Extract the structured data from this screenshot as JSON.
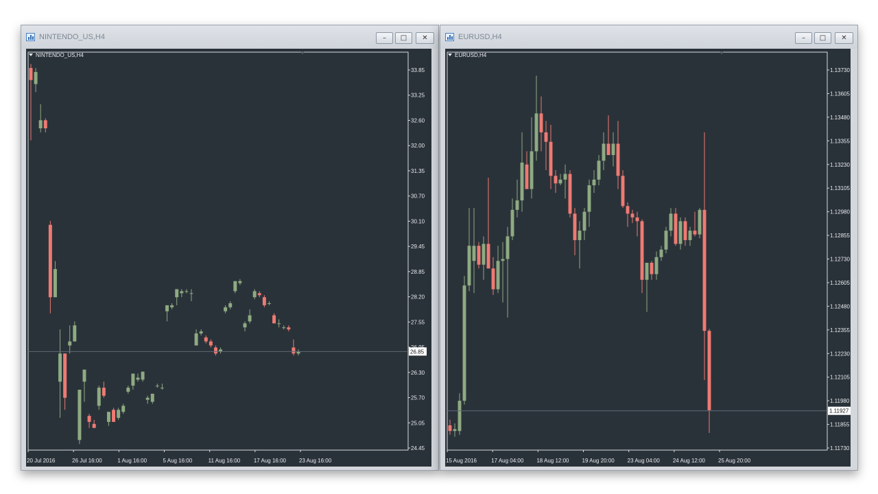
{
  "colors": {
    "bull": "#8eaa82",
    "bear": "#ee7a73",
    "background": "#2a3239",
    "text": "#e8ebee",
    "frame": "#d7dce1"
  },
  "windows": [
    {
      "title": "NINTENDO_US,H4",
      "chart_label": "NINTENDO_US,H4",
      "current_price_label": "26.85",
      "chart_data": {
        "type": "candlestick",
        "symbol": "NINTENDO_US",
        "timeframe": "H4",
        "y_ticks": [
          "33.85",
          "33.25",
          "32.60",
          "32.00",
          "31.35",
          "30.70",
          "30.10",
          "29.45",
          "28.85",
          "28.20",
          "27.55",
          "26.95",
          "26.30",
          "25.70",
          "25.05",
          "24.45"
        ],
        "x_ticks": [
          "20 Jul 2016",
          "26 Jul 16:00",
          "1 Aug 16:00",
          "5 Aug 16:00",
          "11 Aug 16:00",
          "17 Aug 16:00",
          "23 Aug 16:00"
        ],
        "ylim": [
          24.45,
          33.85
        ],
        "current_price": 26.85,
        "candles": [
          {
            "o": 33.9,
            "h": 34.0,
            "l": 32.1,
            "c": 33.6
          },
          {
            "o": 33.5,
            "h": 33.9,
            "l": 33.3,
            "c": 33.8
          },
          {
            "o": 32.4,
            "h": 33.0,
            "l": 32.3,
            "c": 32.6
          },
          {
            "o": 32.6,
            "h": 32.65,
            "l": 32.3,
            "c": 32.4
          },
          {
            "o": 30.0,
            "h": 30.1,
            "l": 27.8,
            "c": 28.2
          },
          {
            "o": 28.2,
            "h": 29.1,
            "l": 28.2,
            "c": 28.9
          },
          {
            "o": 26.1,
            "h": 27.4,
            "l": 25.2,
            "c": 26.8
          },
          {
            "o": 26.8,
            "h": 26.8,
            "l": 25.4,
            "c": 25.7
          },
          {
            "o": 27.0,
            "h": 27.5,
            "l": 26.8,
            "c": 27.1
          },
          {
            "o": 27.1,
            "h": 27.6,
            "l": 27.1,
            "c": 27.5
          },
          {
            "o": 24.65,
            "h": 25.9,
            "l": 24.55,
            "c": 25.9
          },
          {
            "o": 26.1,
            "h": 26.4,
            "l": 25.6,
            "c": 26.4
          },
          {
            "o": 25.25,
            "h": 25.3,
            "l": 24.95,
            "c": 25.1
          },
          {
            "o": 25.05,
            "h": 25.15,
            "l": 24.95,
            "c": 24.95
          },
          {
            "o": 25.5,
            "h": 26.0,
            "l": 25.4,
            "c": 25.95
          },
          {
            "o": 25.95,
            "h": 26.1,
            "l": 25.7,
            "c": 25.75
          },
          {
            "o": 25.1,
            "h": 25.35,
            "l": 25.0,
            "c": 25.35
          },
          {
            "o": 25.4,
            "h": 25.45,
            "l": 25.1,
            "c": 25.1
          },
          {
            "o": 25.2,
            "h": 25.45,
            "l": 25.15,
            "c": 25.4
          },
          {
            "o": 25.35,
            "h": 25.55,
            "l": 25.3,
            "c": 25.5
          },
          {
            "o": 25.85,
            "h": 26.0,
            "l": 25.8,
            "c": 25.95
          },
          {
            "o": 26.0,
            "h": 26.3,
            "l": 25.9,
            "c": 26.3
          },
          {
            "o": 26.15,
            "h": 26.3,
            "l": 26.1,
            "c": 26.2
          },
          {
            "o": 26.15,
            "h": 26.35,
            "l": 26.1,
            "c": 26.35
          },
          {
            "o": 25.65,
            "h": 25.75,
            "l": 25.55,
            "c": 25.7
          },
          {
            "o": 25.6,
            "h": 25.8,
            "l": 25.55,
            "c": 25.8
          },
          {
            "o": 26.0,
            "h": 26.05,
            "l": 25.95,
            "c": 26.0
          },
          {
            "o": 25.95,
            "h": 26.05,
            "l": 25.9,
            "c": 25.95
          },
          {
            "o": 27.85,
            "h": 28.0,
            "l": 27.6,
            "c": 28.0
          },
          {
            "o": 27.95,
            "h": 28.05,
            "l": 27.9,
            "c": 28.0
          },
          {
            "o": 28.2,
            "h": 28.4,
            "l": 28.0,
            "c": 28.4
          },
          {
            "o": 28.3,
            "h": 28.4,
            "l": 28.2,
            "c": 28.35
          },
          {
            "o": 28.35,
            "h": 28.4,
            "l": 28.3,
            "c": 28.35
          },
          {
            "o": 28.3,
            "h": 28.4,
            "l": 28.1,
            "c": 28.3
          },
          {
            "o": 27.0,
            "h": 27.4,
            "l": 27.0,
            "c": 27.3
          },
          {
            "o": 27.3,
            "h": 27.4,
            "l": 27.25,
            "c": 27.35
          },
          {
            "o": 27.2,
            "h": 27.25,
            "l": 27.05,
            "c": 27.1
          },
          {
            "o": 27.1,
            "h": 27.15,
            "l": 26.95,
            "c": 27.0
          },
          {
            "o": 26.95,
            "h": 27.0,
            "l": 26.75,
            "c": 26.8
          },
          {
            "o": 26.85,
            "h": 26.95,
            "l": 26.8,
            "c": 26.9
          },
          {
            "o": 27.85,
            "h": 28.0,
            "l": 27.8,
            "c": 27.95
          },
          {
            "o": 27.95,
            "h": 28.1,
            "l": 27.9,
            "c": 28.05
          },
          {
            "o": 28.35,
            "h": 28.6,
            "l": 28.3,
            "c": 28.6
          },
          {
            "o": 28.55,
            "h": 28.65,
            "l": 28.5,
            "c": 28.6
          },
          {
            "o": 27.45,
            "h": 27.6,
            "l": 27.35,
            "c": 27.55
          },
          {
            "o": 27.6,
            "h": 27.9,
            "l": 27.55,
            "c": 27.75
          },
          {
            "o": 28.2,
            "h": 28.4,
            "l": 28.15,
            "c": 28.35
          },
          {
            "o": 28.3,
            "h": 28.35,
            "l": 28.2,
            "c": 28.25
          },
          {
            "o": 28.2,
            "h": 28.25,
            "l": 27.95,
            "c": 28.0
          },
          {
            "o": 28.05,
            "h": 28.1,
            "l": 28.0,
            "c": 28.05
          },
          {
            "o": 27.75,
            "h": 27.8,
            "l": 27.55,
            "c": 27.55
          },
          {
            "o": 27.55,
            "h": 27.65,
            "l": 27.45,
            "c": 27.55
          },
          {
            "o": 27.45,
            "h": 27.5,
            "l": 27.4,
            "c": 27.45
          },
          {
            "o": 27.45,
            "h": 27.5,
            "l": 27.35,
            "c": 27.4
          },
          {
            "o": 26.95,
            "h": 27.15,
            "l": 26.75,
            "c": 26.8
          },
          {
            "o": 26.8,
            "h": 26.9,
            "l": 26.75,
            "c": 26.85
          }
        ]
      }
    },
    {
      "title": "EURUSD,H4",
      "chart_label": "EURUSD,H4",
      "current_price_label": "1.11927",
      "chart_data": {
        "type": "candlestick",
        "symbol": "EURUSD",
        "timeframe": "H4",
        "y_ticks": [
          "1.13730",
          "1.13605",
          "1.13480",
          "1.13355",
          "1.13230",
          "1.13105",
          "1.12980",
          "1.12855",
          "1.12730",
          "1.12605",
          "1.12480",
          "1.12355",
          "1.12230",
          "1.12105",
          "1.11980",
          "1.11855",
          "1.11730"
        ],
        "x_ticks": [
          "15 Aug 2016",
          "17 Aug 04:00",
          "18 Aug 12:00",
          "19 Aug 20:00",
          "23 Aug 04:00",
          "24 Aug 12:00",
          "25 Aug 20:00"
        ],
        "ylim": [
          1.1173,
          1.1373
        ],
        "current_price": 1.11927,
        "candles": [
          {
            "o": 1.1185,
            "h": 1.1188,
            "l": 1.118,
            "c": 1.1182
          },
          {
            "o": 1.1182,
            "h": 1.1186,
            "l": 1.1179,
            "c": 1.1183
          },
          {
            "o": 1.1182,
            "h": 1.1202,
            "l": 1.118,
            "c": 1.1198
          },
          {
            "o": 1.1198,
            "h": 1.1264,
            "l": 1.1196,
            "c": 1.1259
          },
          {
            "o": 1.1259,
            "h": 1.13,
            "l": 1.1256,
            "c": 1.128
          },
          {
            "o": 1.1272,
            "h": 1.13,
            "l": 1.1255,
            "c": 1.128
          },
          {
            "o": 1.128,
            "h": 1.1282,
            "l": 1.1268,
            "c": 1.127
          },
          {
            "o": 1.127,
            "h": 1.1285,
            "l": 1.1262,
            "c": 1.1281
          },
          {
            "o": 1.1281,
            "h": 1.1316,
            "l": 1.1275,
            "c": 1.1268
          },
          {
            "o": 1.1268,
            "h": 1.1274,
            "l": 1.1254,
            "c": 1.1257
          },
          {
            "o": 1.1257,
            "h": 1.128,
            "l": 1.1255,
            "c": 1.1272
          },
          {
            "o": 1.1272,
            "h": 1.1282,
            "l": 1.125,
            "c": 1.1273
          },
          {
            "o": 1.1273,
            "h": 1.129,
            "l": 1.1242,
            "c": 1.1285
          },
          {
            "o": 1.1285,
            "h": 1.1305,
            "l": 1.1283,
            "c": 1.1299
          },
          {
            "o": 1.1299,
            "h": 1.1315,
            "l": 1.1295,
            "c": 1.1304
          },
          {
            "o": 1.1304,
            "h": 1.134,
            "l": 1.1298,
            "c": 1.1324
          },
          {
            "o": 1.1323,
            "h": 1.133,
            "l": 1.1313,
            "c": 1.131
          },
          {
            "o": 1.131,
            "h": 1.1348,
            "l": 1.1305,
            "c": 1.133
          },
          {
            "o": 1.133,
            "h": 1.137,
            "l": 1.1325,
            "c": 1.135
          },
          {
            "o": 1.135,
            "h": 1.1359,
            "l": 1.133,
            "c": 1.134
          },
          {
            "o": 1.134,
            "h": 1.1346,
            "l": 1.132,
            "c": 1.1335
          },
          {
            "o": 1.1335,
            "h": 1.1344,
            "l": 1.131,
            "c": 1.1317
          },
          {
            "o": 1.1317,
            "h": 1.132,
            "l": 1.1308,
            "c": 1.1313
          },
          {
            "o": 1.1313,
            "h": 1.1318,
            "l": 1.1312,
            "c": 1.1315
          },
          {
            "o": 1.1315,
            "h": 1.1323,
            "l": 1.1305,
            "c": 1.1318
          },
          {
            "o": 1.1318,
            "h": 1.132,
            "l": 1.1295,
            "c": 1.1297
          },
          {
            "o": 1.1297,
            "h": 1.13,
            "l": 1.1275,
            "c": 1.1283
          },
          {
            "o": 1.1283,
            "h": 1.1293,
            "l": 1.1268,
            "c": 1.1288
          },
          {
            "o": 1.1288,
            "h": 1.13,
            "l": 1.1283,
            "c": 1.1298
          },
          {
            "o": 1.1298,
            "h": 1.1315,
            "l": 1.129,
            "c": 1.1312
          },
          {
            "o": 1.1312,
            "h": 1.132,
            "l": 1.1308,
            "c": 1.1315
          },
          {
            "o": 1.1315,
            "h": 1.1328,
            "l": 1.1312,
            "c": 1.1325
          },
          {
            "o": 1.1325,
            "h": 1.134,
            "l": 1.132,
            "c": 1.1334
          },
          {
            "o": 1.1334,
            "h": 1.1349,
            "l": 1.1328,
            "c": 1.1328
          },
          {
            "o": 1.1328,
            "h": 1.134,
            "l": 1.1322,
            "c": 1.1334
          },
          {
            "o": 1.1334,
            "h": 1.1346,
            "l": 1.131,
            "c": 1.1317
          },
          {
            "o": 1.1317,
            "h": 1.132,
            "l": 1.13,
            "c": 1.1301
          },
          {
            "o": 1.1301,
            "h": 1.1303,
            "l": 1.129,
            "c": 1.1297
          },
          {
            "o": 1.1297,
            "h": 1.1299,
            "l": 1.1292,
            "c": 1.1295
          },
          {
            "o": 1.1295,
            "h": 1.1298,
            "l": 1.1285,
            "c": 1.1293
          },
          {
            "o": 1.1293,
            "h": 1.1294,
            "l": 1.1255,
            "c": 1.1262
          },
          {
            "o": 1.1262,
            "h": 1.1271,
            "l": 1.1245,
            "c": 1.1271
          },
          {
            "o": 1.1271,
            "h": 1.1272,
            "l": 1.1262,
            "c": 1.1265
          },
          {
            "o": 1.1265,
            "h": 1.1277,
            "l": 1.1262,
            "c": 1.1274
          },
          {
            "o": 1.1274,
            "h": 1.128,
            "l": 1.1272,
            "c": 1.1278
          },
          {
            "o": 1.1278,
            "h": 1.129,
            "l": 1.1276,
            "c": 1.1288
          },
          {
            "o": 1.1288,
            "h": 1.13,
            "l": 1.1285,
            "c": 1.1297
          },
          {
            "o": 1.1297,
            "h": 1.13,
            "l": 1.128,
            "c": 1.1281
          },
          {
            "o": 1.1281,
            "h": 1.1295,
            "l": 1.1278,
            "c": 1.1293
          },
          {
            "o": 1.1293,
            "h": 1.1295,
            "l": 1.128,
            "c": 1.1283
          },
          {
            "o": 1.1283,
            "h": 1.129,
            "l": 1.128,
            "c": 1.1288
          },
          {
            "o": 1.1288,
            "h": 1.1298,
            "l": 1.1285,
            "c": 1.1286
          },
          {
            "o": 1.1286,
            "h": 1.13,
            "l": 1.1284,
            "c": 1.1299
          },
          {
            "o": 1.1299,
            "h": 1.134,
            "l": 1.1209,
            "c": 1.1235
          },
          {
            "o": 1.1235,
            "h": 1.1236,
            "l": 1.1181,
            "c": 1.1193
          }
        ]
      }
    }
  ]
}
